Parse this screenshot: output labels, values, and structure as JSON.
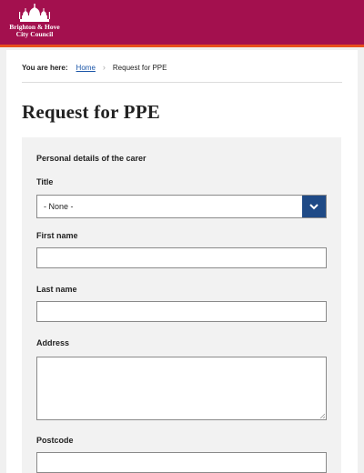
{
  "header": {
    "logo_line1": "Brighton & Hove",
    "logo_line2": "City Council",
    "logo_icon": "royal-pavilion-icon"
  },
  "breadcrumb": {
    "label": "You are here:",
    "home": "Home",
    "separator_icon": "chevron-right-icon",
    "current": "Request for PPE"
  },
  "page_title": "Request for PPE",
  "form": {
    "legend": "Personal details of the carer",
    "title": {
      "label": "Title",
      "selected": "- None -",
      "icon": "chevron-down-icon"
    },
    "first_name": {
      "label": "First name",
      "value": ""
    },
    "last_name": {
      "label": "Last name",
      "value": ""
    },
    "address": {
      "label": "Address",
      "value": ""
    },
    "postcode": {
      "label": "Postcode",
      "value": ""
    }
  },
  "colors": {
    "header_bg": "#a3104e",
    "header_accent": "#e84f1c",
    "select_button": "#1f4a86",
    "link": "#1a55a8"
  }
}
